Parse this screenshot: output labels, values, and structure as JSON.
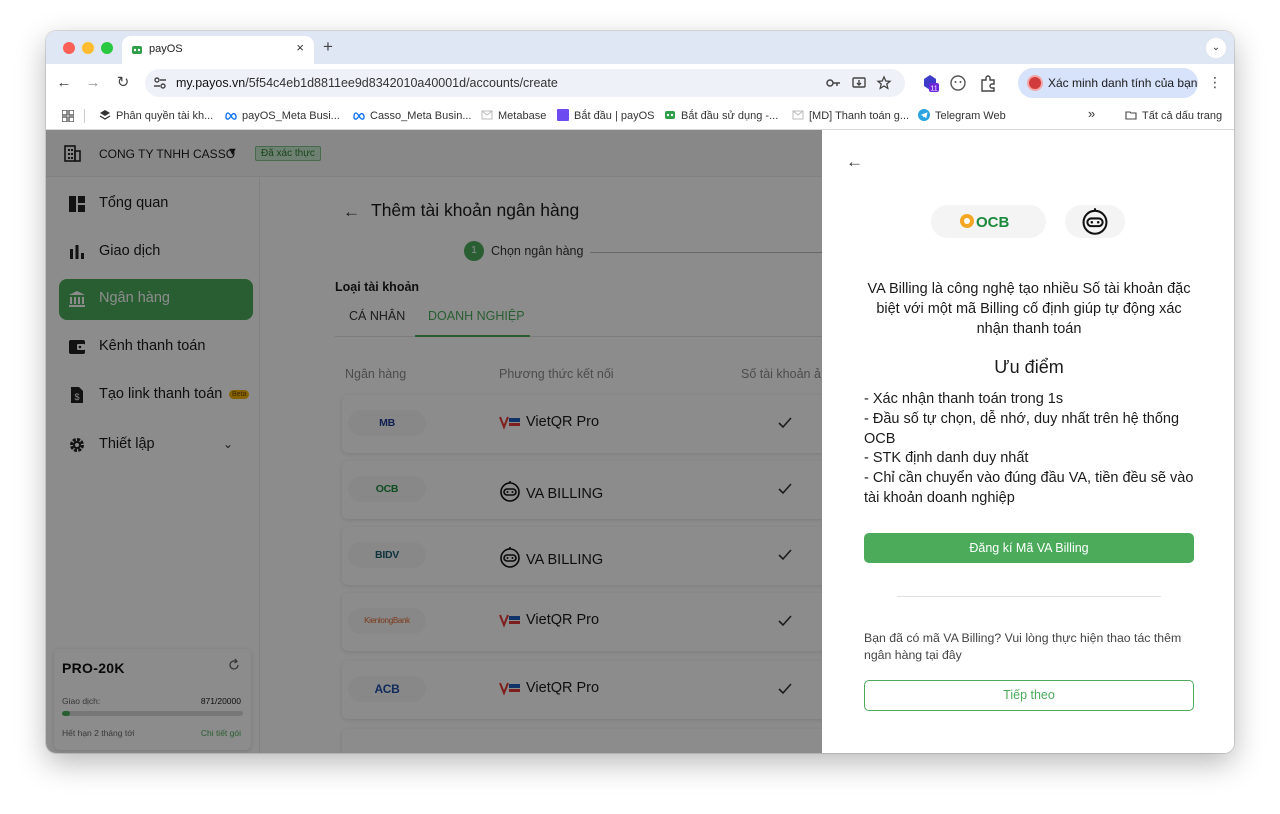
{
  "browser": {
    "tab_title": "payOS",
    "tab_close": "×",
    "new_tab": "+",
    "url_domain": "my.payos.vn",
    "url_path": "/5f54c4eb1d8811ee9d8342010a40001d/accounts/create",
    "extension_badge": "11",
    "profile_text": "Xác minh danh tính của bạn",
    "bookmarks": [
      {
        "label": "Phân quyền tài kh...",
        "icon": "layers-icon"
      },
      {
        "label": "payOS_Meta Busi...",
        "icon": "meta-icon"
      },
      {
        "label": "Casso_Meta Busin...",
        "icon": "meta-icon"
      },
      {
        "label": "Metabase",
        "icon": "gmail-icon"
      },
      {
        "label": "Bắt đầu | payOS",
        "icon": "square-icon"
      },
      {
        "label": "Bắt đầu sử dụng -...",
        "icon": "payos-icon"
      },
      {
        "label": "[MD] Thanh toán g...",
        "icon": "gmail-icon"
      },
      {
        "label": "Telegram Web",
        "icon": "telegram-icon"
      }
    ],
    "bookmarks_more": "»",
    "all_bookmarks": "Tất cả dấu trang"
  },
  "header": {
    "company": "CONG TY TNHH CASSO",
    "verified": "Đã xác thực"
  },
  "sidebar": {
    "items": [
      {
        "label": "Tổng quan",
        "icon": "dashboard-icon"
      },
      {
        "label": "Giao dịch",
        "icon": "bar-chart-icon"
      },
      {
        "label": "Ngân hàng",
        "icon": "bank-icon",
        "active": true
      },
      {
        "label": "Kênh thanh toán",
        "icon": "wallet-icon"
      },
      {
        "label": "Tạo link thanh toán",
        "icon": "invoice-icon",
        "badge": "Beta"
      },
      {
        "label": "Thiết lập",
        "icon": "gear-icon"
      }
    ],
    "plan": {
      "name": "PRO-20K",
      "usage_label": "Giao dịch:",
      "usage_value": "871/20000",
      "usage_fraction": 0.0436,
      "expiry": "Hết hạn 2 tháng tới",
      "detail_link": "Chi tiết gói"
    }
  },
  "main": {
    "title": "Thêm tài khoản ngân hàng",
    "step_number": "1",
    "step_label": "Chọn ngân hàng",
    "account_type_label": "Loại tài khoản",
    "tabs": [
      {
        "label": "CÁ NHÂN"
      },
      {
        "label": "DOANH NGHIỆP",
        "active": true
      }
    ],
    "columns": [
      "Ngân hàng",
      "Phương thức kết nối",
      "Số tài khoản ả"
    ],
    "rows": [
      {
        "bank": "MB",
        "method": "VietQR Pro",
        "method_icon": "vietqr-icon"
      },
      {
        "bank": "OCB",
        "method": "VA BILLING",
        "method_icon": "robot-icon"
      },
      {
        "bank": "BIDV",
        "method": "VA BILLING",
        "method_icon": "robot-icon"
      },
      {
        "bank": "KienlongBank",
        "method": "VietQR Pro",
        "method_icon": "vietqr-icon"
      },
      {
        "bank": "ACB",
        "method": "VietQR Pro",
        "method_icon": "vietqr-icon"
      }
    ]
  },
  "drawer": {
    "bank_logo_text": "OCB",
    "description": "VA Billing là công nghệ tạo nhiều Số tài khoản đặc biệt với một mã Billing cố định giúp tự động xác nhận thanh toán",
    "advantages_title": "Ưu điểm",
    "advantages": [
      "- Xác nhận thanh toán trong 1s",
      "- Đầu số tự chọn, dễ nhớ, duy nhất trên hệ thống OCB",
      "- STK định danh duy nhất",
      "- Chỉ cần chuyển vào đúng đầu VA, tiền đều sẽ vào tài khoản doanh nghiệp"
    ],
    "register_button": "Đăng kí Mã VA Billing",
    "note": "Bạn đã có mã VA Billing? Vui lòng thực hiện thao tác thêm ngân hàng tại đây",
    "next_button": "Tiếp theo"
  },
  "colors": {
    "brand_green": "#4bab5b",
    "overlay": "rgba(0,0,0,0.45)"
  }
}
